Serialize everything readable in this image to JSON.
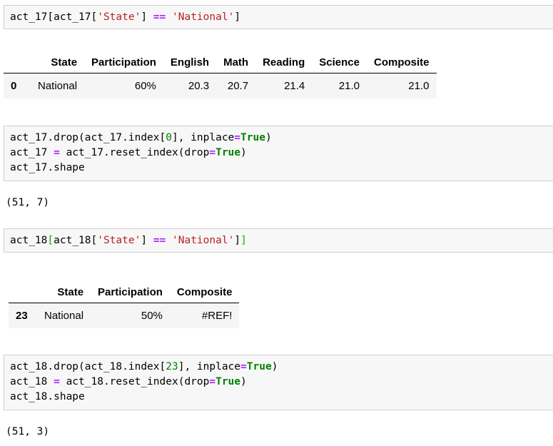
{
  "cells": {
    "c1": {
      "p1": "act_17[act_17[",
      "s1": "'State'",
      "p2": "] ",
      "op": "==",
      "p3": " ",
      "s2": "'National'",
      "p4": "]"
    },
    "c2": {
      "l1a": "act_17.drop(act_17.index[",
      "l1n": "0",
      "l1b": "], inplace",
      "l1op": "=",
      "l1kw": "True",
      "l1c": ")",
      "l2a": "act_17 ",
      "l2op": "=",
      "l2b": " act_17.reset_index(drop",
      "l2op2": "=",
      "l2kw": "True",
      "l2c": ")",
      "l3": "act_17.shape"
    },
    "c3": {
      "p1": "act_18",
      "b1": "[",
      "p2": "act_18[",
      "s1": "'State'",
      "p3": "] ",
      "op": "==",
      "p4": " ",
      "s2": "'National'",
      "p5": "]",
      "b2": "]"
    },
    "c4": {
      "l1a": "act_18.drop(act_18.index[",
      "l1n": "23",
      "l1b": "], inplace",
      "l1op": "=",
      "l1kw": "True",
      "l1c": ")",
      "l2a": "act_18 ",
      "l2op": "=",
      "l2b": " act_18.reset_index(drop",
      "l2op2": "=",
      "l2kw": "True",
      "l2c": ")",
      "l3": "act_18.shape"
    }
  },
  "outputs": {
    "shape1": "(51, 7)",
    "shape2": "(51, 3)"
  },
  "table1": {
    "columns": [
      "",
      "State",
      "Participation",
      "English",
      "Math",
      "Reading",
      "Science",
      "Composite"
    ],
    "row": [
      "0",
      "National",
      "60%",
      "20.3",
      "20.7",
      "21.4",
      "21.0",
      "21.0"
    ]
  },
  "table2": {
    "columns": [
      "",
      "State",
      "Participation",
      "Composite"
    ],
    "row": [
      "23",
      "National",
      "50%",
      "#REF!"
    ]
  }
}
